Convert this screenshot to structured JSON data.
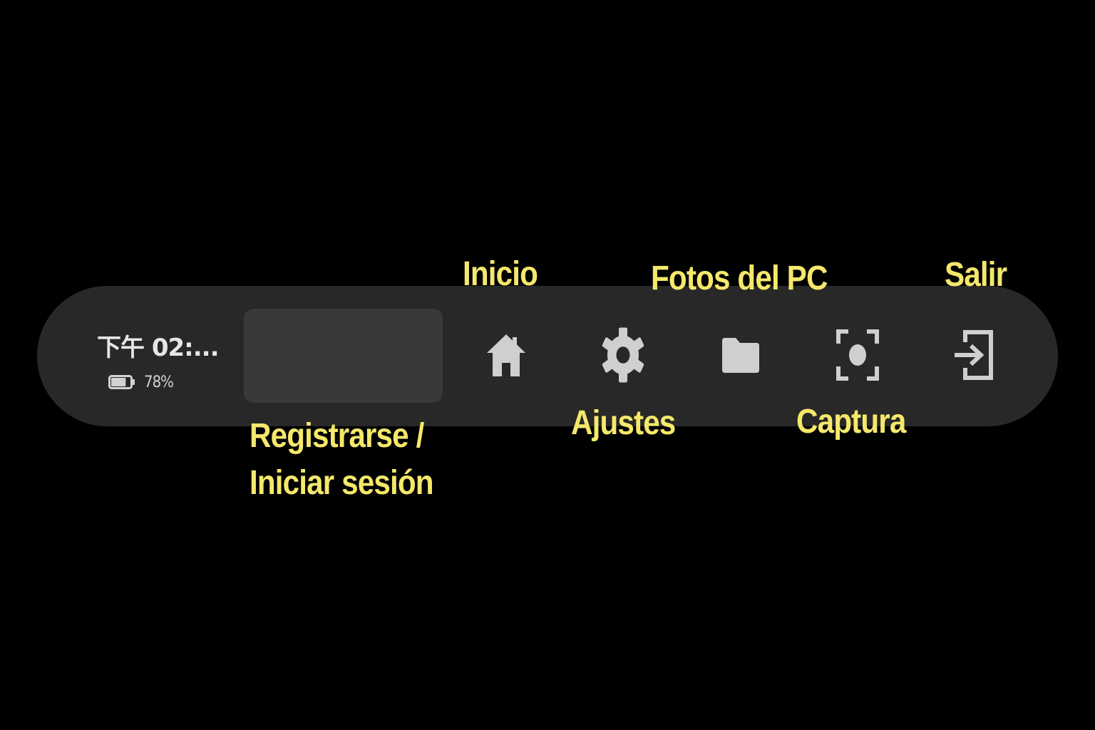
{
  "status": {
    "time": "下午 02:...",
    "battery_percent": "78%",
    "battery_level": 0.78,
    "battery_icon": "battery-icon"
  },
  "toolbar": {
    "login_button_label": "",
    "buttons": [
      {
        "id": "home",
        "icon": "home-icon"
      },
      {
        "id": "settings",
        "icon": "gear-icon"
      },
      {
        "id": "pc-photos",
        "icon": "folder-icon"
      },
      {
        "id": "capture",
        "icon": "screenshot-capture-icon"
      },
      {
        "id": "exit",
        "icon": "exit-arrow-icon"
      }
    ]
  },
  "annotations": {
    "inicio": "Inicio",
    "fotos_del_pc": "Fotos del PC",
    "salir": "Salir",
    "ajustes": "Ajustes",
    "captura": "Captura",
    "login_line1": "Registrarse /",
    "login_line2": "Iniciar sesión"
  },
  "colors": {
    "background": "#000000",
    "bar": "#282828",
    "login_button": "#393939",
    "icon": "#cfcfcf",
    "callout_text": "#f5e86b"
  }
}
